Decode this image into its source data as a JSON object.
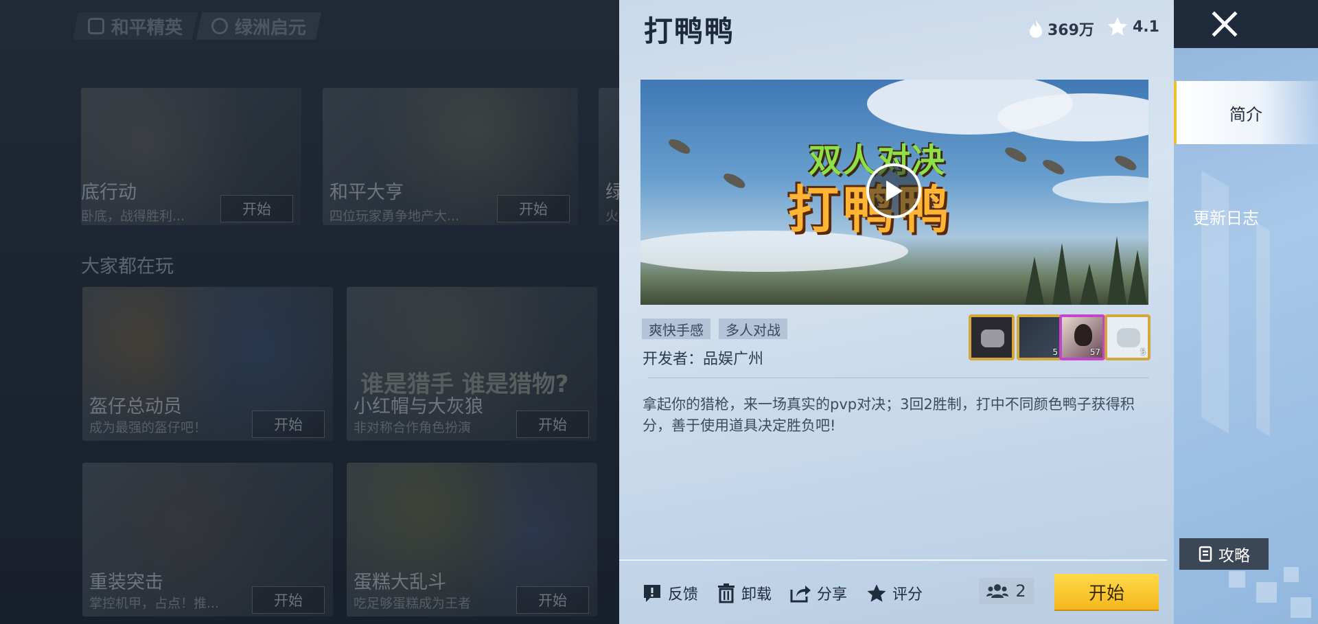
{
  "background": {
    "brand_tabs": [
      "和平精英",
      "绿洲启元"
    ],
    "section_title": "大家都在玩",
    "top_row": [
      {
        "title": "底行动",
        "subtitle": "卧底，战得胜利...",
        "start": "开始"
      },
      {
        "title": "和平大亨",
        "subtitle": "四位玩家勇争地产大...",
        "start": "开始"
      },
      {
        "title": "绿",
        "subtitle": "火",
        "start": ""
      }
    ],
    "grid": [
      {
        "title": "盔仔总动员",
        "subtitle": "成为最强的盔仔吧！",
        "start": "开始"
      },
      {
        "title": "小红帽与大灰狼",
        "subtitle": "非对称合作角色扮演",
        "start": "开始"
      },
      {
        "title": "重装突击",
        "subtitle": "掌控机甲，占点！推...",
        "start": "开始"
      },
      {
        "title": "蛋糕大乱斗",
        "subtitle": "吃足够蛋糕成为王者",
        "start": "开始"
      }
    ],
    "banner_text": "谁是猎手 谁是猎物?"
  },
  "panel": {
    "title": "打鸭鸭",
    "heat": "369万",
    "rating": "4.1",
    "video_logo_top": "双人对决",
    "video_logo_bottom": "打鸭鸭",
    "tags": [
      "爽快手感",
      "多人对战"
    ],
    "developer": "开发者：品娱广州",
    "avatar_levels": [
      "",
      "5",
      "57",
      "5"
    ],
    "description": "拿起你的猎枪，来一场真实的pvp对决；3回2胜制，打中不同颜色鸭子获得积分，善于使用道具决定胜负吧!",
    "actions": {
      "feedback": "反馈",
      "uninstall": "卸载",
      "share": "分享",
      "rate": "评分"
    },
    "players": "2",
    "start": "开始"
  },
  "sidenav": {
    "intro": "简介",
    "changelog": "更新日志",
    "guide": "攻略"
  },
  "colors": {
    "accent": "#f5c02a",
    "panel_bg": "#d3e0ee",
    "title": "#1d2a3a"
  }
}
